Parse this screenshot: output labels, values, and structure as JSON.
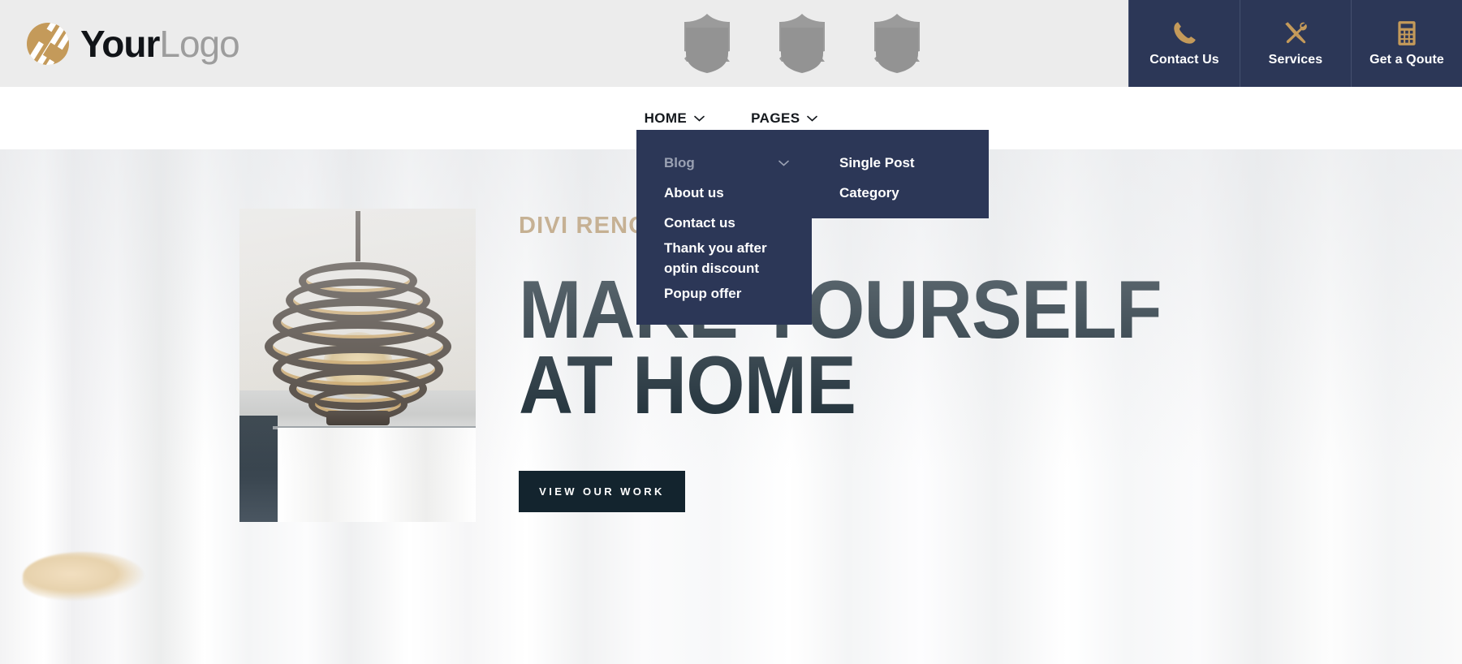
{
  "brand": {
    "logo_primary": "Your",
    "logo_secondary": "Logo",
    "gold": "#c49a5a",
    "navy": "#2c3757",
    "dark": "#13242e"
  },
  "topbar": {
    "badges": [
      {
        "icon": "shield-badge-icon"
      },
      {
        "icon": "shield-badge-icon"
      },
      {
        "icon": "shield-badge-icon"
      }
    ],
    "quick_links": [
      {
        "label": "Contact Us",
        "icon": "phone-icon"
      },
      {
        "label": "Services",
        "icon": "tools-icon"
      },
      {
        "label": "Get a Qoute",
        "icon": "calculator-icon"
      }
    ]
  },
  "nav": {
    "items": [
      {
        "label": "HOME",
        "icon": "chevron-down-icon",
        "has_dropdown": true
      },
      {
        "label": "PAGES",
        "icon": "chevron-down-icon",
        "has_dropdown": true
      }
    ]
  },
  "dropdown": {
    "open_for": "PAGES",
    "items": [
      {
        "label": "Blog",
        "state": "hover",
        "icon": "chevron-down-icon",
        "has_submenu": true
      },
      {
        "label": "About us",
        "state": "normal",
        "has_submenu": false
      },
      {
        "label": "Contact us",
        "state": "normal",
        "has_submenu": false
      },
      {
        "label": "Thank you after\noptin discount",
        "state": "normal",
        "has_submenu": false
      },
      {
        "label": "Popup offer",
        "state": "normal",
        "has_submenu": false
      }
    ],
    "submenu": {
      "items": [
        {
          "label": "Single Post"
        },
        {
          "label": "Category"
        }
      ]
    }
  },
  "hero": {
    "kicker": "DIVI RENOVATION",
    "title_line1": "MAKE YOURSELF",
    "title_line2": "AT HOME",
    "cta_label": "VIEW OUR WORK",
    "image_alt": "spiral-chandelier-photo"
  }
}
